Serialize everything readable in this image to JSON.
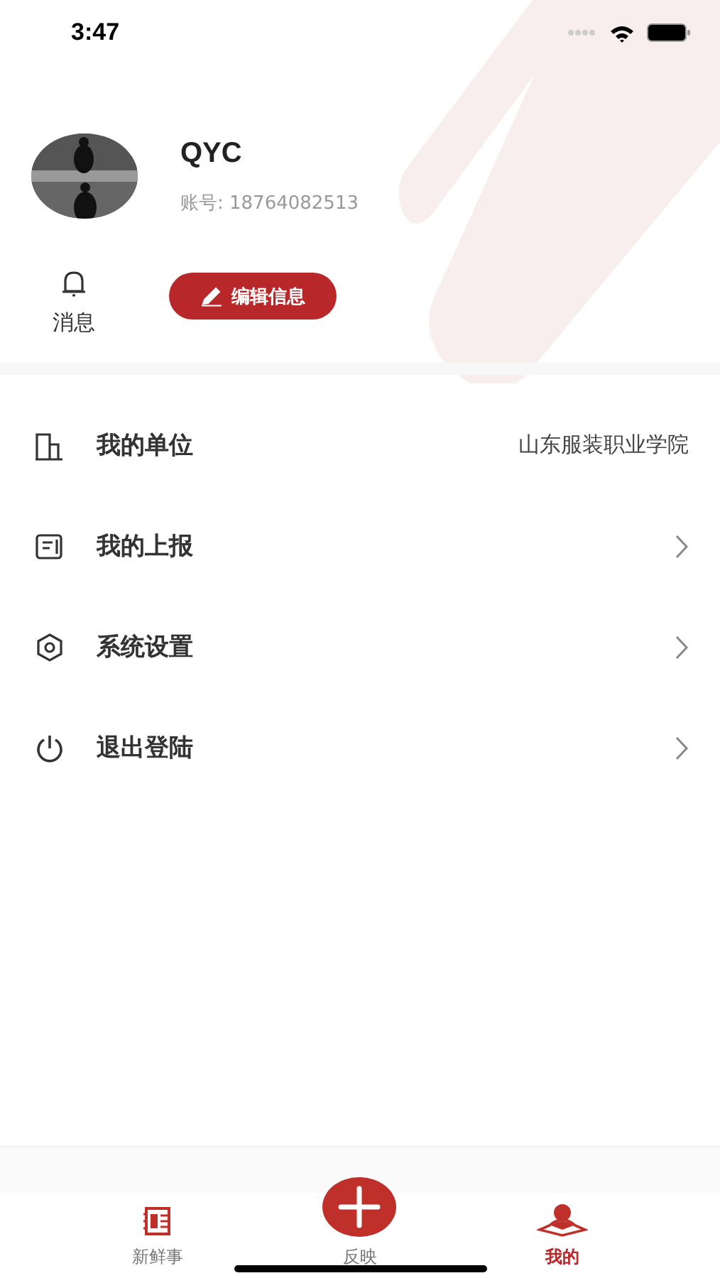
{
  "status_bar": {
    "time": "3:47"
  },
  "profile": {
    "name": "QYC",
    "account": "账号: 18764082513",
    "edit_button": "编辑信息"
  },
  "shortcuts": [
    {
      "kind": "bell",
      "label": "消息"
    }
  ],
  "menu": [
    {
      "kind": "building",
      "label": "我的单位",
      "value": "山东服装职业学院",
      "chevron": false
    },
    {
      "kind": "report",
      "label": "我的上报",
      "chevron": true
    },
    {
      "kind": "settings",
      "label": "系统设置",
      "chevron": true
    },
    {
      "kind": "power",
      "label": "退出登陆",
      "chevron": true
    }
  ],
  "tab_bar": [
    {
      "kind": "news",
      "label": "新鲜事",
      "selected": false
    },
    {
      "kind": "plus",
      "label": "反映",
      "selected": false
    },
    {
      "kind": "person",
      "label": "我的",
      "selected": true
    }
  ]
}
